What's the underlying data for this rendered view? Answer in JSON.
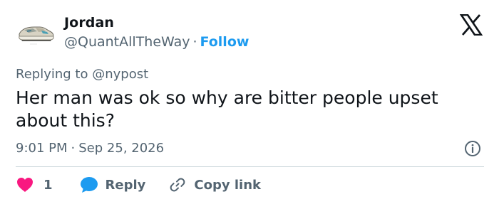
{
  "author": {
    "name": "Jordan",
    "handle": "@QuantAllTheWay",
    "separator": "·",
    "follow_label": "Follow"
  },
  "tweet": {
    "replying_prefix": "Replying to",
    "replying_to": "@nypost",
    "text": "Her man was ok so why are bitter people upset about this?",
    "time": "9:01 PM",
    "separator": "·",
    "date": "Sep 25, 2026"
  },
  "actions": {
    "like_count": "1",
    "reply_label": "Reply",
    "copy_label": "Copy link"
  },
  "colors": {
    "accent": "#1d9bf0",
    "like": "#f91880",
    "muted": "#536471",
    "text": "#0f1419",
    "divider": "#cfd9de"
  },
  "icons": [
    "sneaker-avatar",
    "x-logo-icon",
    "info-icon",
    "heart-icon",
    "speech-bubble-icon",
    "link-icon"
  ]
}
